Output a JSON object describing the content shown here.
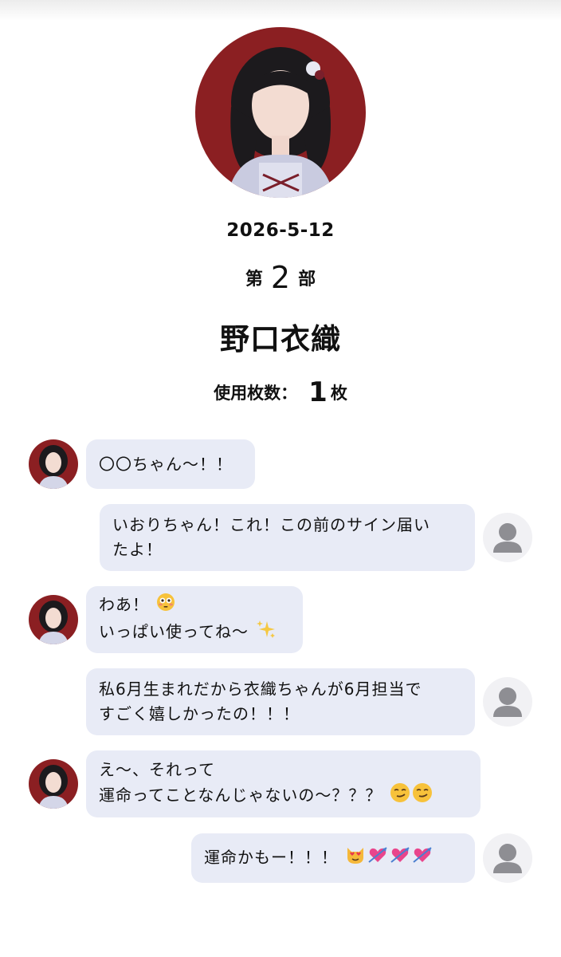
{
  "header": {
    "date": "2026-5-12",
    "part_prefix": "第",
    "part_number": "2",
    "part_suffix": "部",
    "member_name": "野口衣織",
    "used_label": "使用枚数：",
    "used_count": "1",
    "used_unit": "枚"
  },
  "messages": [
    {
      "from": "member",
      "lines": [
        "〇〇ちゃん〜！！"
      ]
    },
    {
      "from": "user",
      "lines": [
        "いおりちゃん！これ！この前のサイン届い",
        "たよ！"
      ]
    },
    {
      "from": "member",
      "lines": [
        "わあ！",
        "いっぱい使ってね〜"
      ],
      "emojis": [
        "flushed-face",
        "sparkles"
      ]
    },
    {
      "from": "user",
      "lines": [
        "私6月生まれだから衣織ちゃんが6月担当で",
        "すごく嬉しかったの！！！"
      ]
    },
    {
      "from": "member",
      "lines": [
        "え〜、それって",
        "運命ってことなんじゃないの〜？？？"
      ],
      "emojis": [
        "smirking-face",
        "smirking-face"
      ]
    },
    {
      "from": "user",
      "lines": [
        "運命かもー！！！"
      ],
      "emojis": [
        "heart-eyes-cat",
        "heart-with-arrow",
        "heart-with-arrow",
        "heart-with-arrow"
      ]
    }
  ],
  "colors": {
    "bubble": "#e8ebf6",
    "avatar_background": "#8b1f22",
    "user_avatar_icon": "#8e8e93"
  }
}
